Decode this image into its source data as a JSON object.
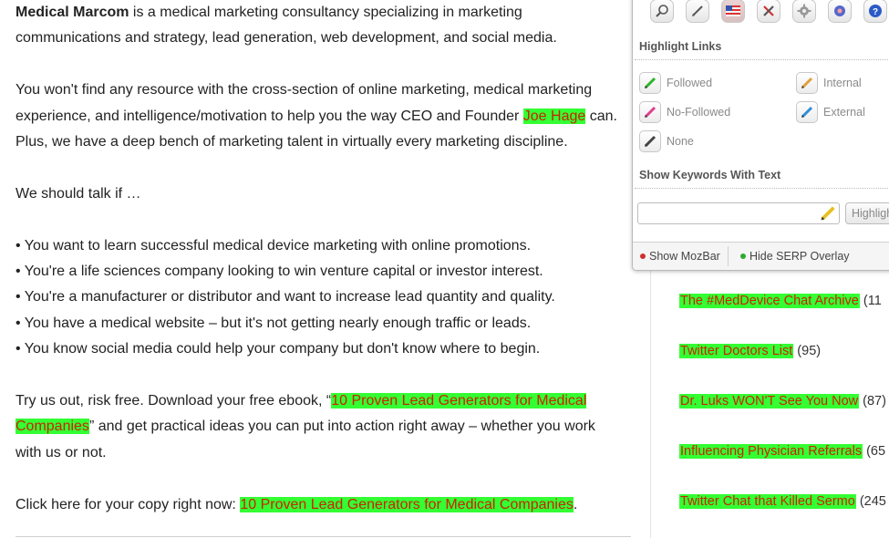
{
  "article": {
    "p1_bold": "Medical Marcom",
    "p1_rest": " is a medical marketing consultancy specializing in marketing",
    "p1_line2": "communications and strategy, lead generation, web development, and social media.",
    "p2_line1": "You won't find any resource with the cross-section of online marketing, medical marketing",
    "p2_line2_pre": "experience, and intelligence/motivation to help you the way CEO and Founder ",
    "p2_link": "Joe Hage",
    "p2_line2_post": " can.",
    "p2_line3": "Plus, we have a deep bench of marketing talent in virtually every marketing discipline.",
    "p3": "We should talk if …",
    "bullets": [
      "• You want to learn successful medical device marketing with online promotions.",
      "• You're a life sciences company looking to win venture capital or investor interest.",
      "• You're a manufacturer or distributor and want to increase lead quantity and quality.",
      "• You have a medical website – but it's not getting nearly enough traffic or leads.",
      "• You know social media could help your company but don't know where to begin."
    ],
    "p4_pre": "Try us out, risk free. Download your free ebook, “",
    "p4_link_a": "10 Proven Lead Generators for Medical",
    "p4_link_b": "Companies",
    "p4_post": "” and get practical ideas you can put into action right away – whether you work",
    "p4_line3": "with us or not.",
    "p5_pre": "Click here for your copy right now: ",
    "p5_link": "10 Proven Lead Generators for Medical Companies",
    "p5_post": "."
  },
  "sidebar": {
    "items": [
      {
        "link": "The #MedDevice Chat Archive",
        "count": " (11"
      },
      {
        "link": "Twitter Doctors List",
        "count": " (95)"
      },
      {
        "link": "Dr. Luks WON'T See You Now",
        "count": " (87)"
      },
      {
        "link": "Influencing Physician Referrals",
        "count": " (65"
      },
      {
        "link": "Twitter Chat that Killed Sermo",
        "count": " (245"
      }
    ]
  },
  "mozbar": {
    "toolbar_icons": [
      "magnifier-icon",
      "pencil-icon",
      "flag-icon",
      "tools-icon",
      "gear-icon",
      "settings-icon",
      "help-icon"
    ],
    "highlight_links_title": "Highlight Links",
    "options": {
      "followed": "Followed",
      "internal": "Internal",
      "nofollowed": "No-Followed",
      "external": "External",
      "none": "None"
    },
    "keywords_title": "Show Keywords With Text",
    "keyword_input_value": "",
    "highlight_button": "Highlight",
    "footer": {
      "show_mozbar": "Show MozBar",
      "hide_serp": "Hide SERP Overlay"
    },
    "colors": {
      "followed_pen": "#2db52d",
      "internal_pen": "#e0a040",
      "nofollowed_pen": "#e0408f",
      "external_pen": "#2f8fd8",
      "none_pen": "#444444",
      "show_dot": "#d03030",
      "hide_dot": "#2fa82f"
    }
  },
  "colors": {
    "highlight_bg": "#33ff33",
    "highlight_text": "#cc2200"
  }
}
